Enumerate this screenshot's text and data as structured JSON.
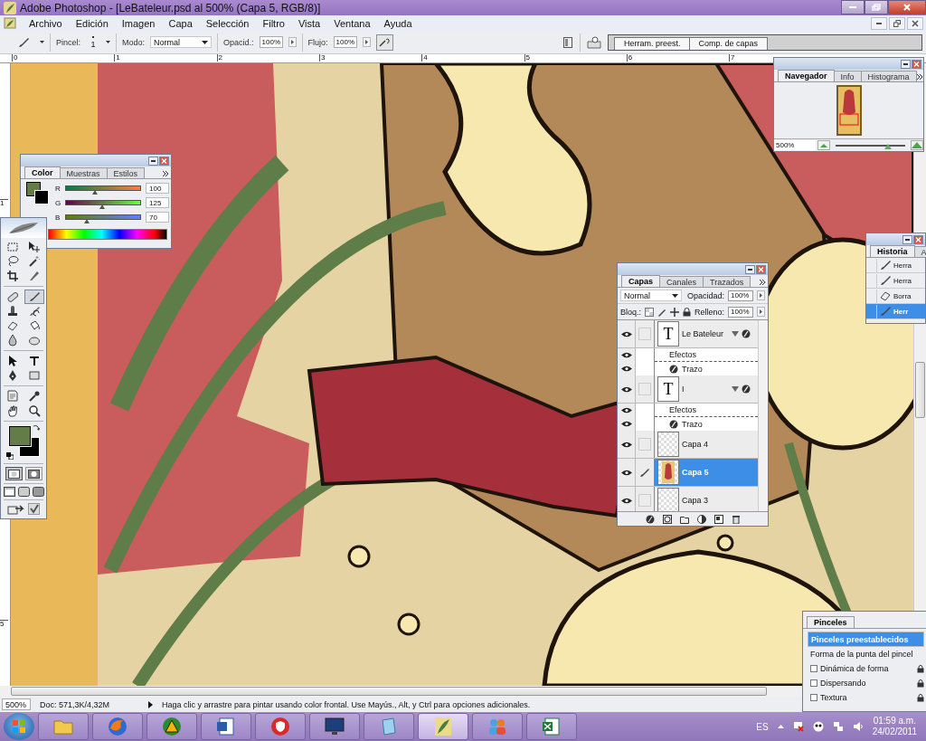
{
  "window": {
    "title": "Adobe Photoshop - [LeBateleur.psd al 500% (Capa 5, RGB/8)]"
  },
  "menu": [
    "Archivo",
    "Edición",
    "Imagen",
    "Capa",
    "Selección",
    "Filtro",
    "Vista",
    "Ventana",
    "Ayuda"
  ],
  "options_bar": {
    "brush_label": "Pincel:",
    "brush_size": "1",
    "mode_label": "Modo:",
    "mode": "Normal",
    "opacity_label": "Opacid.:",
    "opacity": "100%",
    "flow_label": "Flujo:",
    "flow": "100%",
    "airbrush": false,
    "palette_well": [
      "Herram. preest.",
      "Comp. de capas"
    ]
  },
  "rulers": {
    "horizontal": [
      "0",
      "1",
      "2",
      "3",
      "4",
      "5",
      "6",
      "7"
    ],
    "vertical": [
      "1",
      "5"
    ]
  },
  "color_panel": {
    "tabs": [
      {
        "label": "Color",
        "selected": true
      },
      {
        "label": "Muestras",
        "selected": false
      },
      {
        "label": "Estilos",
        "selected": false
      }
    ],
    "channels": [
      {
        "name": "R",
        "level": 0.392,
        "value": "100"
      },
      {
        "name": "G",
        "level": 0.49,
        "value": "125"
      },
      {
        "name": "B",
        "level": 0.275,
        "value": "70"
      }
    ]
  },
  "toolbox": {
    "tools": [
      {
        "kind": "marquee",
        "selected": false
      },
      {
        "kind": "move",
        "selected": false
      },
      {
        "kind": "lasso",
        "selected": false
      },
      {
        "kind": "wand",
        "selected": false
      },
      {
        "kind": "crop",
        "selected": false
      },
      {
        "kind": "slice",
        "selected": false
      },
      {
        "kind": "healing",
        "selected": false
      },
      {
        "kind": "brush",
        "selected": true
      },
      {
        "kind": "stamp",
        "selected": false
      },
      {
        "kind": "history",
        "selected": false
      },
      {
        "kind": "eraser",
        "selected": false
      },
      {
        "kind": "bucket",
        "selected": false
      },
      {
        "kind": "blur",
        "selected": false
      },
      {
        "kind": "dodge",
        "selected": false
      },
      {
        "kind": "pointer",
        "selected": false
      },
      {
        "kind": "type",
        "selected": false
      },
      {
        "kind": "pen",
        "selected": false
      },
      {
        "kind": "shape",
        "selected": false
      },
      {
        "kind": "notes",
        "selected": false
      },
      {
        "kind": "eyedropper",
        "selected": false
      },
      {
        "kind": "hand",
        "selected": false
      },
      {
        "kind": "zoom",
        "selected": false
      }
    ],
    "mask_modes": [
      {
        "selected": true
      },
      {
        "selected": false
      }
    ]
  },
  "navigator": {
    "tabs": [
      {
        "label": "Navegador",
        "selected": true
      },
      {
        "label": "Info",
        "selected": false
      },
      {
        "label": "Histograma",
        "selected": false
      }
    ],
    "zoom": "500%",
    "level": 0.75
  },
  "history": {
    "tabs": [
      {
        "label": "Historia",
        "selected": true
      },
      {
        "label": "A",
        "selected": false
      }
    ],
    "items": [
      {
        "kind": "brush",
        "label": "Herra",
        "selected": false
      },
      {
        "kind": "brush",
        "label": "Herra",
        "selected": false
      },
      {
        "kind": "eraser",
        "label": "Borra",
        "selected": false
      },
      {
        "kind": "brush",
        "label": "Herr",
        "selected": true
      }
    ]
  },
  "layers": {
    "tabs": [
      {
        "label": "Capas",
        "selected": true
      },
      {
        "label": "Canales",
        "selected": false
      },
      {
        "label": "Trazados",
        "selected": false
      }
    ],
    "blend_mode": "Normal",
    "opacity_label": "Opacidad:",
    "opacity": "100%",
    "lock_label": "Bloq.:",
    "fill_label": "Relleno:",
    "fill": "100%",
    "items": [
      {
        "kind": "text",
        "name": "Le Bateleur",
        "thumbnail_text": "T",
        "visible": true,
        "selected": false,
        "expanded": true,
        "effects": {
          "label": "Efectos",
          "visible": true,
          "items": [
            {
              "name": "Trazo",
              "visible": true
            }
          ]
        }
      },
      {
        "kind": "text",
        "name": "I",
        "thumbnail_text": "T",
        "visible": true,
        "selected": false,
        "expanded": true,
        "effects": {
          "label": "Efectos",
          "visible": true,
          "items": [
            {
              "name": "Trazo",
              "visible": true
            }
          ]
        }
      },
      {
        "kind": "empty",
        "name": "Capa 4",
        "visible": true,
        "selected": false
      },
      {
        "kind": "image",
        "name": "Capa 5",
        "visible": true,
        "selected": true
      },
      {
        "kind": "empty",
        "name": "Capa 3",
        "visible": true,
        "selected": false
      }
    ]
  },
  "brushes_panel": {
    "tab": "Pinceles",
    "items": [
      {
        "kind": "header",
        "label": "Pinceles preestablecidos",
        "selected": true
      },
      {
        "kind": "plain",
        "label": "Forma de la punta del pincel",
        "selected": false
      },
      {
        "kind": "option",
        "label": "Dinámica de forma",
        "checked": false
      },
      {
        "kind": "option",
        "label": "Dispersando",
        "checked": false
      },
      {
        "kind": "option",
        "label": "Textura",
        "checked": false
      }
    ]
  },
  "status_bar": {
    "zoom": "500%",
    "doc": "Doc: 571,3K/4,32M",
    "hint": "Haga clic y arrastre para pintar usando color frontal. Use Mayús., Alt, y Ctrl para opciones adicionales."
  },
  "taskbar": {
    "apps": [
      {
        "kind": "folder",
        "selected": false
      },
      {
        "kind": "browser",
        "selected": false
      },
      {
        "kind": "triangle",
        "selected": false
      },
      {
        "kind": "word",
        "selected": false
      },
      {
        "kind": "shield",
        "selected": false
      },
      {
        "kind": "monitor",
        "selected": false
      },
      {
        "kind": "notepad",
        "selected": false
      },
      {
        "kind": "feather",
        "selected": true
      },
      {
        "kind": "people",
        "selected": false
      },
      {
        "kind": "excel",
        "selected": false
      }
    ],
    "language": "ES",
    "time": "01:59 a.m.",
    "date": "24/02/2011"
  }
}
